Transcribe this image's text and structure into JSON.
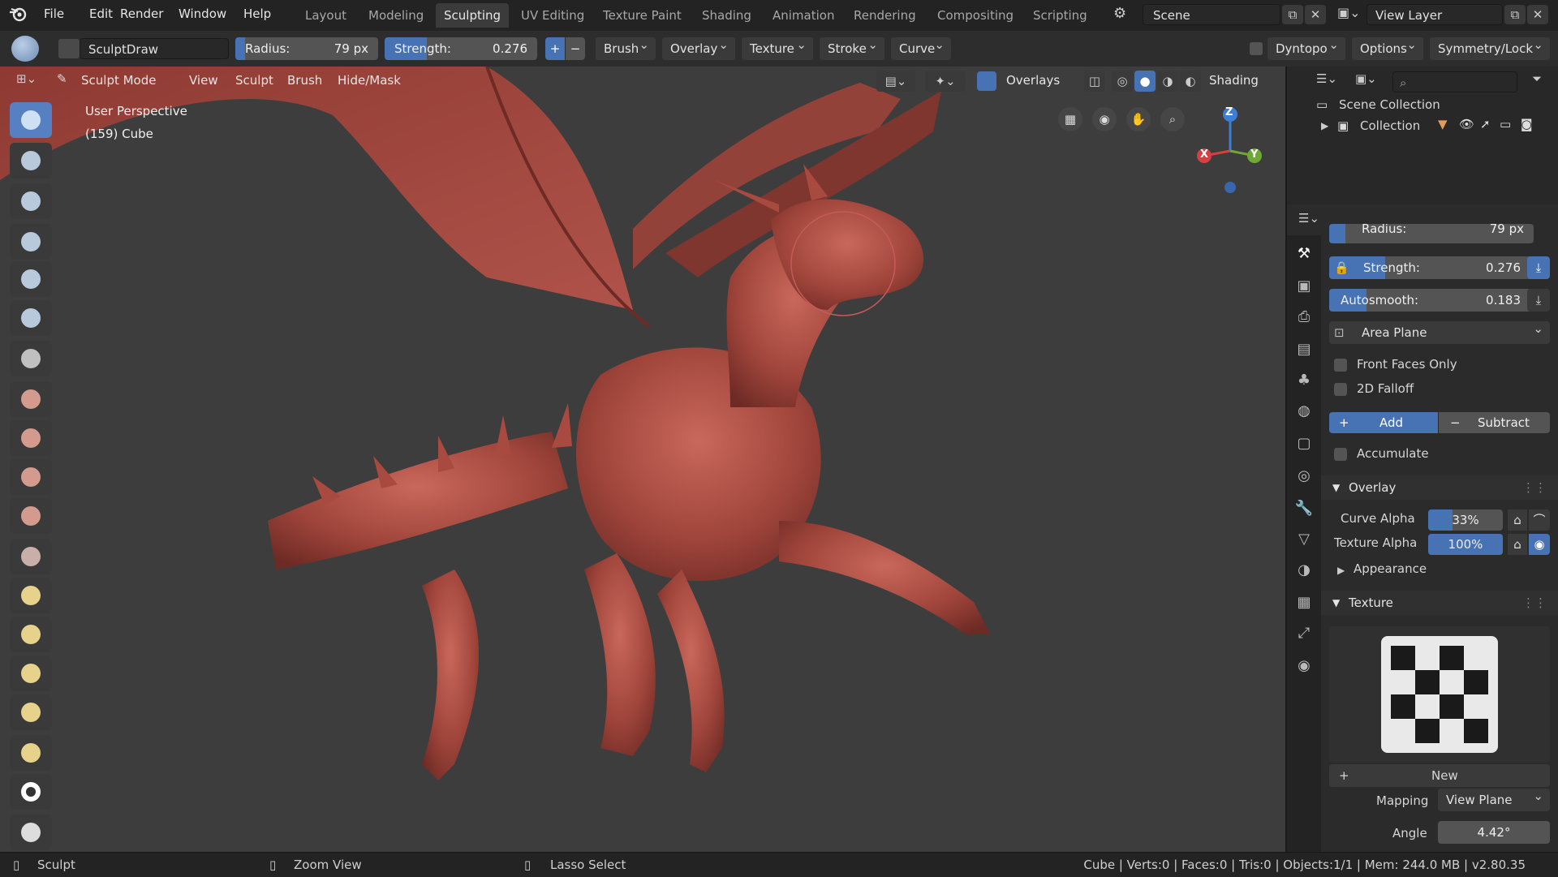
{
  "menu": {
    "items": [
      "File",
      "Edit",
      "Render",
      "Window",
      "Help"
    ],
    "workspaces": [
      "Layout",
      "Modeling",
      "Sculpting",
      "UV Editing",
      "Texture Paint",
      "Shading",
      "Animation",
      "Rendering",
      "Compositing",
      "Scripting"
    ],
    "active_workspace": "Sculpting",
    "scene": "Scene",
    "view_layer": "View Layer"
  },
  "tool_header": {
    "brush_name": "SculptDraw",
    "radius_label": "Radius:",
    "radius_value": "79 px",
    "strength_label": "Strength:",
    "strength_value": "0.276",
    "strength_fraction": 0.276,
    "plus": "+",
    "minus": "−",
    "dropdowns": [
      "Brush",
      "Overlay",
      "Texture",
      "Stroke",
      "Curve"
    ],
    "dyntopo": "Dyntopo",
    "options": "Options",
    "symmetry": "Symmetry/Lock"
  },
  "viewport_header": {
    "mode": "Sculpt Mode",
    "menus": [
      "View",
      "Sculpt",
      "Brush",
      "Hide/Mask"
    ],
    "overlays": "Overlays",
    "shading": "Shading"
  },
  "viewport": {
    "perspective": "User Perspective",
    "object": "(159) Cube",
    "gizmo": {
      "x": "X",
      "y": "Y",
      "z": "Z"
    },
    "colors": {
      "background": "#3d3d3d",
      "model": "#a0453b",
      "brush_cursor": "#c65a5a"
    }
  },
  "outliner": {
    "scene_collection": "Scene Collection",
    "collection": "Collection"
  },
  "properties": {
    "radius_label": "Radius:",
    "radius_value": "79 px",
    "strength_label": "Strength:",
    "strength_value": "0.276",
    "autosmooth_label": "Autosmooth:",
    "autosmooth_value": "0.183",
    "autosmooth_fraction": 0.183,
    "area_plane": "Area Plane",
    "front_faces": "Front Faces Only",
    "falloff_2d": "2D Falloff",
    "add": "Add",
    "subtract": "Subtract",
    "accumulate": "Accumulate",
    "overlay_section": "Overlay",
    "curve_alpha_label": "Curve Alpha",
    "curve_alpha_value": "33%",
    "texture_alpha_label": "Texture Alpha",
    "texture_alpha_value": "100%",
    "appearance_section": "Appearance",
    "texture_section": "Texture",
    "new_label": "New",
    "mapping_label": "Mapping",
    "mapping_value": "View Plane",
    "angle_label": "Angle",
    "angle_value": "4.42°"
  },
  "status": {
    "left": "Sculpt",
    "middle": "Zoom View",
    "right": "Lasso Select",
    "stats": "Cube | Verts:0 | Faces:0 | Tris:0 | Objects:1/1 | Mem: 244.0 MB | v2.80.35"
  },
  "accent": "#4772b3"
}
